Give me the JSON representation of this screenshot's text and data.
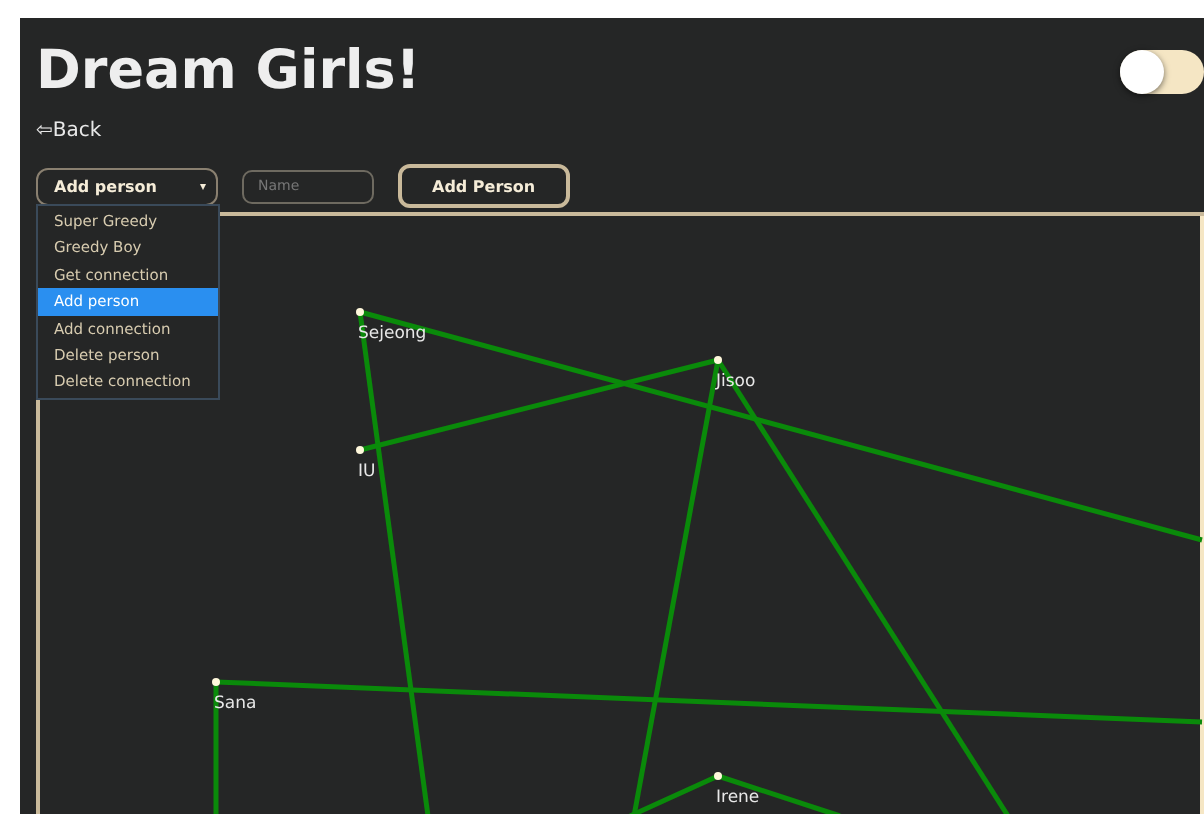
{
  "title": "Dream Girls!",
  "back_link": "⇦Back",
  "theme_toggle": {
    "on": false
  },
  "action_select": {
    "value": "Add person",
    "caret": "▾",
    "options": [
      {
        "label": "Super Greedy",
        "selected": false
      },
      {
        "label": "Greedy Boy",
        "selected": false
      },
      {
        "label": "Get connection",
        "selected": false
      },
      {
        "label": "Add person",
        "selected": true
      },
      {
        "label": "Add connection",
        "selected": false
      },
      {
        "label": "Delete person",
        "selected": false
      },
      {
        "label": "Delete connection",
        "selected": false
      }
    ]
  },
  "name_field": {
    "placeholder": "Name"
  },
  "submit_button": "Add Person",
  "graph": {
    "nodes": [
      {
        "name": "Sejeong"
      },
      {
        "name": "Jisoo"
      },
      {
        "name": "IU"
      },
      {
        "name": "Sana"
      },
      {
        "name": "Irene"
      }
    ]
  }
}
